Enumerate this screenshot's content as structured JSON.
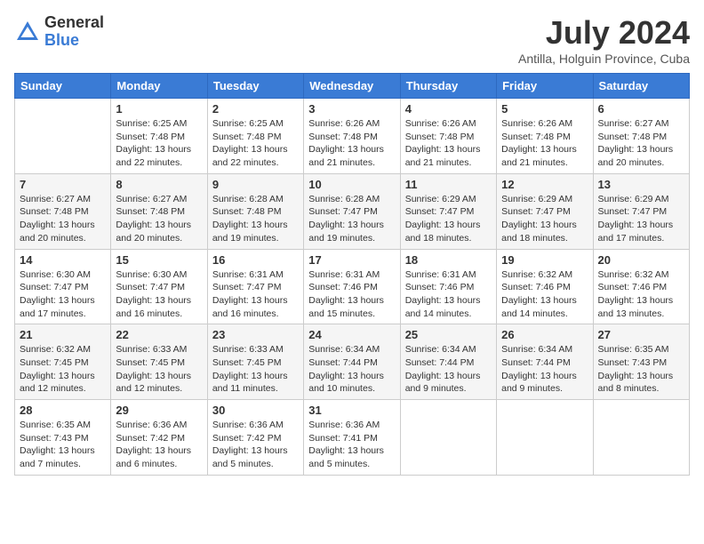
{
  "logo": {
    "general": "General",
    "blue": "Blue"
  },
  "title": "July 2024",
  "subtitle": "Antilla, Holguin Province, Cuba",
  "weekdays": [
    "Sunday",
    "Monday",
    "Tuesday",
    "Wednesday",
    "Thursday",
    "Friday",
    "Saturday"
  ],
  "weeks": [
    [
      {
        "day": "",
        "info": ""
      },
      {
        "day": "1",
        "info": "Sunrise: 6:25 AM\nSunset: 7:48 PM\nDaylight: 13 hours\nand 22 minutes."
      },
      {
        "day": "2",
        "info": "Sunrise: 6:25 AM\nSunset: 7:48 PM\nDaylight: 13 hours\nand 22 minutes."
      },
      {
        "day": "3",
        "info": "Sunrise: 6:26 AM\nSunset: 7:48 PM\nDaylight: 13 hours\nand 21 minutes."
      },
      {
        "day": "4",
        "info": "Sunrise: 6:26 AM\nSunset: 7:48 PM\nDaylight: 13 hours\nand 21 minutes."
      },
      {
        "day": "5",
        "info": "Sunrise: 6:26 AM\nSunset: 7:48 PM\nDaylight: 13 hours\nand 21 minutes."
      },
      {
        "day": "6",
        "info": "Sunrise: 6:27 AM\nSunset: 7:48 PM\nDaylight: 13 hours\nand 20 minutes."
      }
    ],
    [
      {
        "day": "7",
        "info": "Sunrise: 6:27 AM\nSunset: 7:48 PM\nDaylight: 13 hours\nand 20 minutes."
      },
      {
        "day": "8",
        "info": "Sunrise: 6:27 AM\nSunset: 7:48 PM\nDaylight: 13 hours\nand 20 minutes."
      },
      {
        "day": "9",
        "info": "Sunrise: 6:28 AM\nSunset: 7:48 PM\nDaylight: 13 hours\nand 19 minutes."
      },
      {
        "day": "10",
        "info": "Sunrise: 6:28 AM\nSunset: 7:47 PM\nDaylight: 13 hours\nand 19 minutes."
      },
      {
        "day": "11",
        "info": "Sunrise: 6:29 AM\nSunset: 7:47 PM\nDaylight: 13 hours\nand 18 minutes."
      },
      {
        "day": "12",
        "info": "Sunrise: 6:29 AM\nSunset: 7:47 PM\nDaylight: 13 hours\nand 18 minutes."
      },
      {
        "day": "13",
        "info": "Sunrise: 6:29 AM\nSunset: 7:47 PM\nDaylight: 13 hours\nand 17 minutes."
      }
    ],
    [
      {
        "day": "14",
        "info": "Sunrise: 6:30 AM\nSunset: 7:47 PM\nDaylight: 13 hours\nand 17 minutes."
      },
      {
        "day": "15",
        "info": "Sunrise: 6:30 AM\nSunset: 7:47 PM\nDaylight: 13 hours\nand 16 minutes."
      },
      {
        "day": "16",
        "info": "Sunrise: 6:31 AM\nSunset: 7:47 PM\nDaylight: 13 hours\nand 16 minutes."
      },
      {
        "day": "17",
        "info": "Sunrise: 6:31 AM\nSunset: 7:46 PM\nDaylight: 13 hours\nand 15 minutes."
      },
      {
        "day": "18",
        "info": "Sunrise: 6:31 AM\nSunset: 7:46 PM\nDaylight: 13 hours\nand 14 minutes."
      },
      {
        "day": "19",
        "info": "Sunrise: 6:32 AM\nSunset: 7:46 PM\nDaylight: 13 hours\nand 14 minutes."
      },
      {
        "day": "20",
        "info": "Sunrise: 6:32 AM\nSunset: 7:46 PM\nDaylight: 13 hours\nand 13 minutes."
      }
    ],
    [
      {
        "day": "21",
        "info": "Sunrise: 6:32 AM\nSunset: 7:45 PM\nDaylight: 13 hours\nand 12 minutes."
      },
      {
        "day": "22",
        "info": "Sunrise: 6:33 AM\nSunset: 7:45 PM\nDaylight: 13 hours\nand 12 minutes."
      },
      {
        "day": "23",
        "info": "Sunrise: 6:33 AM\nSunset: 7:45 PM\nDaylight: 13 hours\nand 11 minutes."
      },
      {
        "day": "24",
        "info": "Sunrise: 6:34 AM\nSunset: 7:44 PM\nDaylight: 13 hours\nand 10 minutes."
      },
      {
        "day": "25",
        "info": "Sunrise: 6:34 AM\nSunset: 7:44 PM\nDaylight: 13 hours\nand 9 minutes."
      },
      {
        "day": "26",
        "info": "Sunrise: 6:34 AM\nSunset: 7:44 PM\nDaylight: 13 hours\nand 9 minutes."
      },
      {
        "day": "27",
        "info": "Sunrise: 6:35 AM\nSunset: 7:43 PM\nDaylight: 13 hours\nand 8 minutes."
      }
    ],
    [
      {
        "day": "28",
        "info": "Sunrise: 6:35 AM\nSunset: 7:43 PM\nDaylight: 13 hours\nand 7 minutes."
      },
      {
        "day": "29",
        "info": "Sunrise: 6:36 AM\nSunset: 7:42 PM\nDaylight: 13 hours\nand 6 minutes."
      },
      {
        "day": "30",
        "info": "Sunrise: 6:36 AM\nSunset: 7:42 PM\nDaylight: 13 hours\nand 5 minutes."
      },
      {
        "day": "31",
        "info": "Sunrise: 6:36 AM\nSunset: 7:41 PM\nDaylight: 13 hours\nand 5 minutes."
      },
      {
        "day": "",
        "info": ""
      },
      {
        "day": "",
        "info": ""
      },
      {
        "day": "",
        "info": ""
      }
    ]
  ]
}
